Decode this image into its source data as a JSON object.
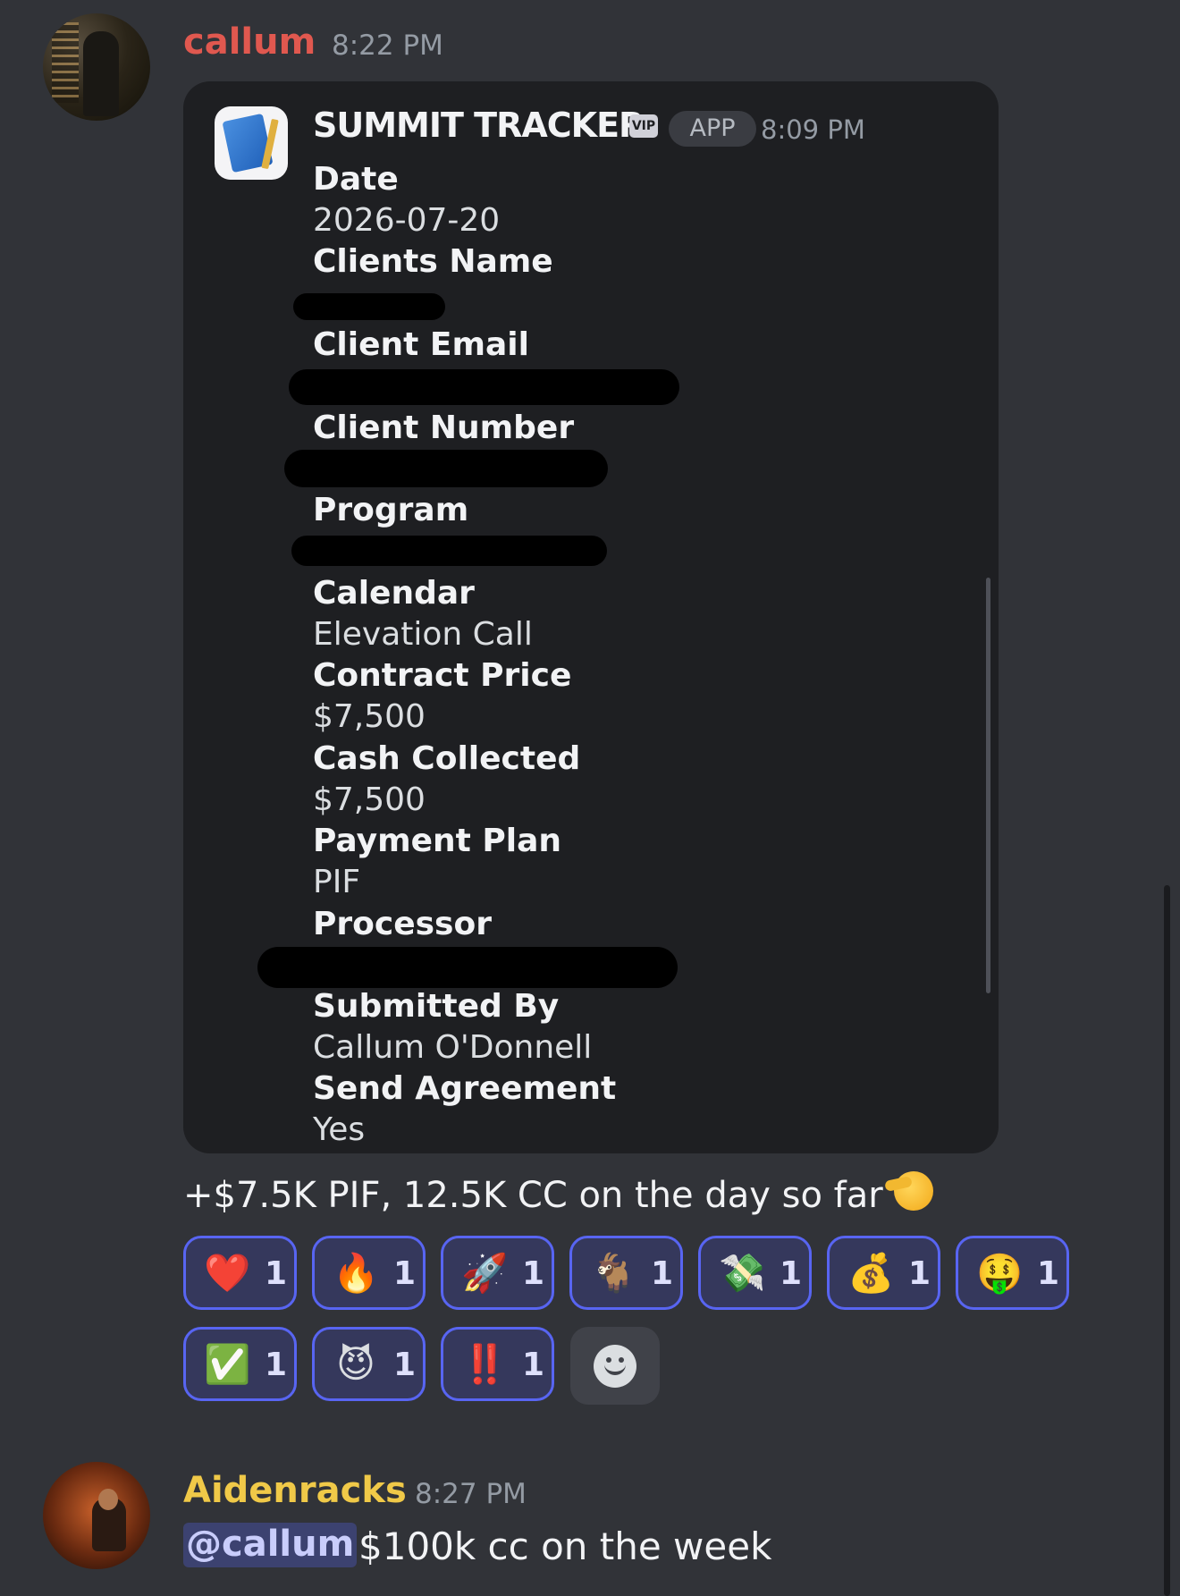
{
  "message_1": {
    "username": "callum",
    "username_color": "#e0584f",
    "timestamp": "8:22 PM",
    "embed": {
      "app_name": "SUMMIT TRACKER",
      "vip_badge": "VIP",
      "app_badge": "APP",
      "timestamp": "8:09 PM",
      "fields": [
        {
          "label": "Date",
          "value": "2026-07-20"
        },
        {
          "label": "Clients Name",
          "value": ""
        },
        {
          "label": "Client Email",
          "value": ""
        },
        {
          "label": "Client Number",
          "value": ""
        },
        {
          "label": "Program",
          "value": ""
        },
        {
          "label": "Calendar",
          "value": "Elevation Call"
        },
        {
          "label": "Contract Price",
          "value": "$7,500"
        },
        {
          "label": "Cash Collected",
          "value": "$7,500"
        },
        {
          "label": "Payment Plan",
          "value": "PIF"
        },
        {
          "label": "Processor",
          "value": ""
        },
        {
          "label": "Submitted By",
          "value": "Callum O'Donnell"
        },
        {
          "label": "Send Agreement",
          "value": "Yes"
        }
      ]
    },
    "text": "+$7.5K PIF, 12.5K CC on the day so far",
    "reactions": [
      {
        "emoji": "❤️",
        "icon": "red-heart",
        "count": "1"
      },
      {
        "emoji": "🔥",
        "icon": "fire",
        "count": "1"
      },
      {
        "emoji": "🚀",
        "icon": "rocket",
        "count": "1"
      },
      {
        "emoji": "🐐",
        "icon": "goat",
        "count": "1"
      },
      {
        "emoji": "💸",
        "icon": "money-with-wings",
        "count": "1"
      },
      {
        "emoji": "💰",
        "icon": "money-bag",
        "count": "1"
      },
      {
        "emoji": "🤑",
        "icon": "money-mouth-face",
        "count": "1"
      },
      {
        "emoji": "✅",
        "icon": "check-mark-button",
        "count": "1"
      },
      {
        "emoji": "😈",
        "icon": "smiling-devil",
        "count": "1"
      },
      {
        "emoji": "‼️",
        "icon": "double-exclamation",
        "count": "1"
      }
    ]
  },
  "message_2": {
    "username": "Aidenracks",
    "username_color": "#f0c948",
    "timestamp": "8:27 PM",
    "mention": "@callum",
    "text": "$100k cc on the week"
  }
}
